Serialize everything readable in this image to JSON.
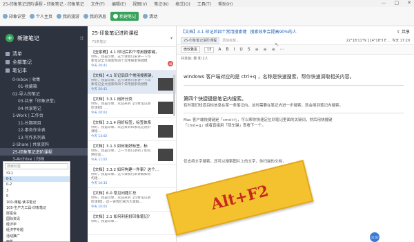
{
  "window": {
    "title": "25-印象笔记进阶课程 - 印象笔记 - 印象笔记",
    "menus": [
      "文件(F)",
      "编辑(E)",
      "视图(V)",
      "笔记(N)",
      "格式(O)",
      "工具(T)",
      "帮助(H)"
    ],
    "controls": [
      "—",
      "□",
      "✕"
    ]
  },
  "toolbar": {
    "items": [
      {
        "label": "印象识堂",
        "icon": "book-icon",
        "active": false
      },
      {
        "label": "个人主页",
        "icon": "user-icon",
        "active": false
      },
      {
        "label": "我的漫游",
        "icon": "globe-icon",
        "active": false
      },
      {
        "label": "我的消息",
        "icon": "message-icon",
        "active": false
      },
      {
        "label": "新建笔记",
        "icon": "plus-icon",
        "active": true
      },
      {
        "label": "清动",
        "icon": "activity-icon",
        "active": false
      }
    ]
  },
  "sidebar": {
    "new_note_label": "新建笔记",
    "items": [
      {
        "label": "清单",
        "icon": "checklist-icon"
      },
      {
        "label": "全部笔记",
        "icon": "notes-icon"
      },
      {
        "label": "笔记本",
        "icon": "notebook-icon"
      }
    ],
    "notebooks": [
      {
        "label": "0-Inbox | 收集",
        "indent": 1,
        "selected": false
      },
      {
        "label": "01-收藏箱",
        "indent": 2,
        "selected": false
      },
      {
        "label": "02-导入的笔记",
        "indent": 1,
        "selected": false
      },
      {
        "label": "03-共享「印象识堂」",
        "indent": 2,
        "selected": false
      },
      {
        "label": "04-共享笔记",
        "indent": 2,
        "selected": false
      },
      {
        "label": "1-Work | 工作台",
        "indent": 1,
        "selected": false
      },
      {
        "label": "11-长期项目",
        "indent": 2,
        "selected": false
      },
      {
        "label": "12-事务作业表",
        "indent": 2,
        "selected": false
      },
      {
        "label": "13-写作系列表",
        "indent": 2,
        "selected": false
      },
      {
        "label": "2-Share | 共享资料",
        "indent": 1,
        "selected": false
      },
      {
        "label": "25-印象笔记进阶课程",
        "indent": 1,
        "selected": true
      },
      {
        "label": "3-Archive | 归档",
        "indent": 1,
        "selected": false
      }
    ]
  },
  "tag_popup": {
    "placeholder": "搜索标签",
    "tags": [
      "!0-1",
      "0-1",
      "0-2",
      "3",
      "5",
      "100-课程-读书笔记",
      "105-生产力工具-印象笔记",
      "财富会",
      "国际资讯",
      "经济学",
      "经济学专题",
      "活动推广",
      "电影",
      "阅读"
    ]
  },
  "notelist": {
    "title": "25-印象笔记进阶课程",
    "count": "73条笔记",
    "sort": "▾",
    "notes": [
      {
        "title": "【全家桶】4.1 印记后四个常用搜索键，",
        "snippet": "你好，我是印象，这节课我们来讲一下印象笔记全文搜索和四个常用搜索快捷键",
        "date": "今天 20:41",
        "selected": false,
        "thumb": false,
        "badge": "48"
      },
      {
        "title": "【文档】4.1 印记后四个常用搜索键，",
        "snippet": "你好，我是印象，这节课我们来讲一下印象笔记全文搜索和四个常用搜索快捷键",
        "date": "今天 20:41",
        "selected": true,
        "thumb": true,
        "badge": ""
      },
      {
        "title": "【文档】3.3.1 用好分类",
        "snippet": "你好，我是印象，欢迎来到【印象笔记进阶课程】...",
        "date": "今天 20:02",
        "selected": false,
        "thumb": true,
        "badge": ""
      },
      {
        "title": "【文档】3.1.4 用好标签，标签体系",
        "snippet": "你好，我是印象，欢迎来到印象笔记进阶课程...",
        "date": "今天 13:02",
        "selected": false,
        "thumb": true,
        "badge": ""
      },
      {
        "title": "【文档】3.1.3 如何用好标签，标",
        "snippet": "你好，我是印象，上一节我们讲到了如何用标签...",
        "date": "今天 11:02",
        "selected": false,
        "thumb": true,
        "badge": ""
      },
      {
        "title": "【文档】3.3.2 如何构建一件事？这个...",
        "snippet": "你好，我是印象，这节课我们来讲解如何构建...",
        "date": "今天 10:35",
        "selected": false,
        "thumb": false,
        "badge": ""
      },
      {
        "title": "【文档】6.0 常见问题汇总",
        "snippet": "你好，我是印象，欢迎来到【印象笔记进阶课程】，这一讲我们来为大家解...",
        "date": "今天 10:05",
        "selected": false,
        "thumb": false,
        "badge": ""
      },
      {
        "title": "【文档】2.1 如何利用好印象笔记？",
        "snippet": "你好，我是印象...",
        "date": "",
        "selected": false,
        "thumb": false,
        "badge": ""
      }
    ]
  },
  "editor": {
    "breadcrumb_tag": "【文档】4.1 印记后四个常用搜索键",
    "keyword_text": "搜索效率会提高90%的人",
    "share_label": "共享",
    "notebook_chip": "25-印象笔记进阶课程",
    "add_tag": "添加标签...",
    "meta": "22°18'11\"N 114°18'3 E   ...   今天 17:20",
    "format_font": "微软雅黑",
    "format_size": "15",
    "format_buttons": [
      "A",
      "B",
      "I",
      "U",
      "S",
      "≡",
      "≡",
      "≡",
      "⋯"
    ],
    "info": "共享给: 我 和 2人",
    "paragraphs": [
      {
        "text": "windows 客户端对应的是 ctrl+q ，名称是快速搜索，帮你快速调取相关内容。",
        "style": "normal"
      },
      {
        "text": "第四个快捷键是笔记内搜索。",
        "style": "heading"
      },
      {
        "text": "有时我们知道目标信息在某一条笔记内，这时需要在笔记内进一步搜索，就会用到笔记内搜索。",
        "style": "small"
      },
      {
        "text": "Mac 客户端快捷键是「cmd+f」，可以帮你快速定位到笔记里面的关键词，然后用快捷键",
        "style": "small"
      },
      {
        "text": "「cmd+g」或者直接用「回车键」查看下一个。",
        "style": "small"
      },
      {
        "text": "仅支持文字搜索，还可以搜索图片上的文字，你扫描的文档，",
        "style": "small"
      }
    ]
  },
  "overlay": {
    "banner_text": "Alt+F2",
    "bubble_text": "01:02",
    "banner_color": "#f4c22f",
    "banner_text_color": "#c7281e"
  }
}
